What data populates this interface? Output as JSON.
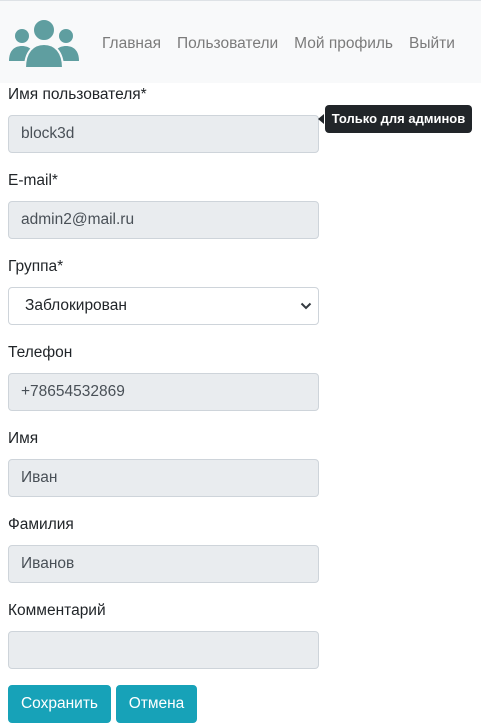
{
  "navbar": {
    "logo_icon": "users-group-icon",
    "links": [
      "Главная",
      "Пользователи",
      "Мой профиль",
      "Выйти"
    ]
  },
  "form": {
    "username": {
      "label": "Имя пользователя*",
      "value": "block3d"
    },
    "tooltip": "Только для админов",
    "email": {
      "label": "E-mail*",
      "value": "admin2@mail.ru"
    },
    "group": {
      "label": "Группа*",
      "selected": "Заблокирован"
    },
    "phone": {
      "label": "Телефон",
      "value": "+78654532869"
    },
    "first_name": {
      "label": "Имя",
      "value": "Иван"
    },
    "last_name": {
      "label": "Фамилия",
      "value": "Иванов"
    },
    "comment": {
      "label": "Комментарий",
      "value": ""
    }
  },
  "actions": {
    "save": "Сохранить",
    "cancel": "Отмена"
  },
  "colors": {
    "accent": "#17a2b8",
    "logo": "#5f9ea0",
    "readonly_bg": "#e9ecef",
    "tooltip_bg": "#212529"
  }
}
